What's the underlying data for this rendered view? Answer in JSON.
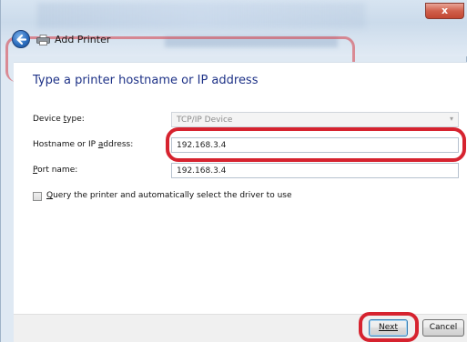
{
  "window": {
    "title": "Add Printer",
    "close_glyph": "x",
    "back_icon": "back-arrow-icon",
    "printer_icon": "printer-icon"
  },
  "page": {
    "heading": "Type a printer hostname or IP address"
  },
  "form": {
    "device_type": {
      "label": "Device type:",
      "value": "TCP/IP Device",
      "arrow": "▾"
    },
    "hostname": {
      "label": "Hostname or IP address:",
      "value": "192.168.3.4"
    },
    "port_name": {
      "label": "Port name:",
      "value": "192.168.3.4"
    },
    "query_checkbox": {
      "label": "Query the printer and automatically select the driver to use",
      "checked": false
    }
  },
  "buttons": {
    "next": "Next",
    "cancel": "Cancel"
  },
  "colors": {
    "heading": "#1e3287",
    "highlight_ring": "#d6232f",
    "close_button": "#c24732"
  }
}
